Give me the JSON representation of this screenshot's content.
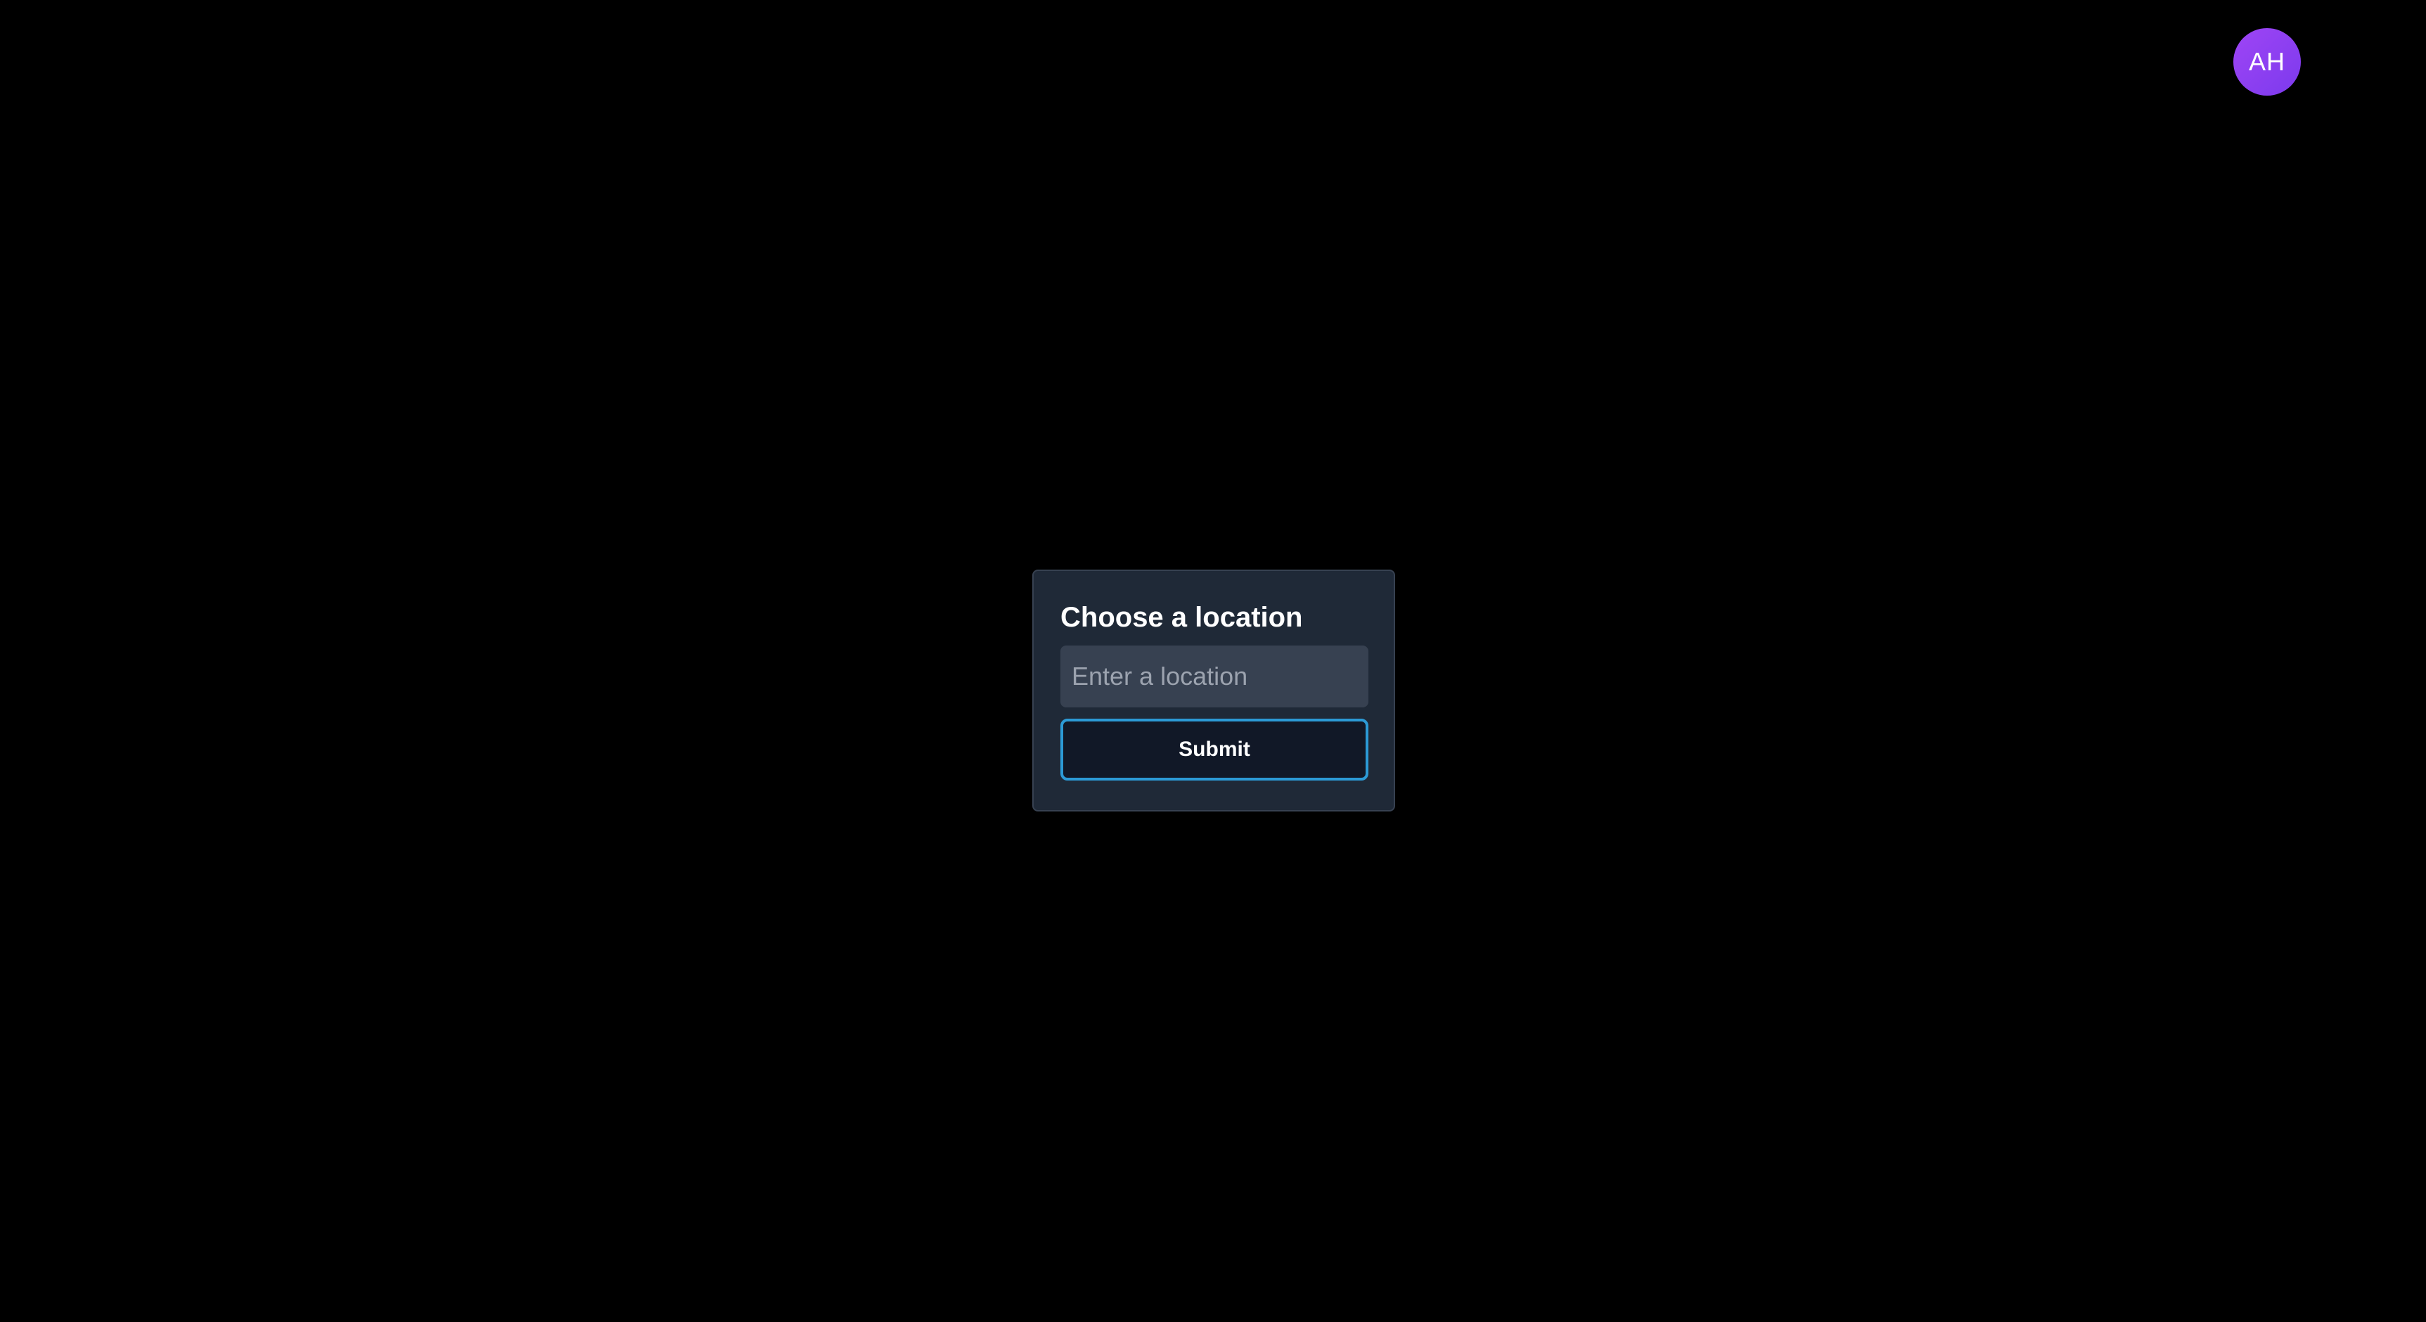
{
  "user": {
    "initials": "AH"
  },
  "location_dialog": {
    "title": "Choose a location",
    "input_placeholder": "Enter a location",
    "input_value": "",
    "submit_label": "Submit"
  },
  "colors": {
    "background": "#000000",
    "card": "#1f2937",
    "input": "#374151",
    "button_border": "#2c9ad6",
    "avatar": "#9f45f5"
  }
}
